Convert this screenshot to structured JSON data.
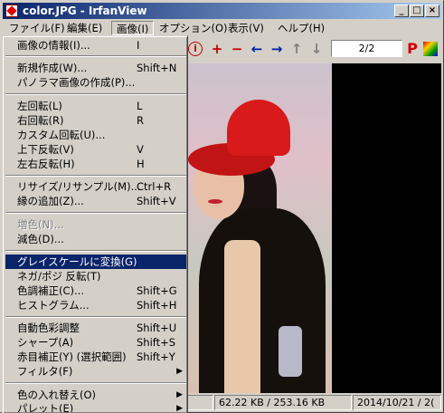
{
  "window": {
    "title": "color.JPG - IrfanView",
    "buttons": [
      "_",
      "□",
      "×"
    ]
  },
  "menubar": {
    "items": [
      {
        "label": "ファイル(F)"
      },
      {
        "label": "編集(E)"
      },
      {
        "label": "画像(I)"
      },
      {
        "label": "オプション(O)"
      },
      {
        "label": "表示(V)"
      },
      {
        "label": "ヘルプ(H)"
      }
    ]
  },
  "toolbar": {
    "page": "2/2",
    "icons": {
      "info": "i",
      "zoom_in": "+",
      "zoom_out": "−",
      "prev": "←",
      "next": "→",
      "up": "↑",
      "down": "↓",
      "print": "P"
    }
  },
  "image_menu": {
    "items": [
      {
        "label": "画像の情報(I)...",
        "shortcut": "I"
      },
      {
        "label": "新規作成(W)...",
        "shortcut": "Shift+N"
      },
      {
        "label": "パノラマ画像の作成(P)...",
        "shortcut": ""
      },
      {
        "label": "左回転(L)",
        "shortcut": "L"
      },
      {
        "label": "右回転(R)",
        "shortcut": "R"
      },
      {
        "label": "カスタム回転(U)...",
        "shortcut": ""
      },
      {
        "label": "上下反転(V)",
        "shortcut": "V"
      },
      {
        "label": "左右反転(H)",
        "shortcut": "H"
      },
      {
        "label": "リサイズ/リサンプル(M)...",
        "shortcut": "Ctrl+R"
      },
      {
        "label": "縁の追加(Z)...",
        "shortcut": "Shift+V"
      },
      {
        "label": "増色(N)...",
        "shortcut": ""
      },
      {
        "label": "減色(D)...",
        "shortcut": ""
      },
      {
        "label": "グレイスケールに変換(G)",
        "shortcut": ""
      },
      {
        "label": "ネガ/ポジ 反転(T)",
        "shortcut": ""
      },
      {
        "label": "色調補正(C)...",
        "shortcut": "Shift+G"
      },
      {
        "label": "ヒストグラム...",
        "shortcut": "Shift+H"
      },
      {
        "label": "自動色彩調整",
        "shortcut": "Shift+U"
      },
      {
        "label": "シャープ(A)",
        "shortcut": "Shift+S"
      },
      {
        "label": "赤目補正(Y) (選択範囲)",
        "shortcut": "Shift+Y"
      },
      {
        "label": "フィルタ(F)",
        "shortcut": ""
      },
      {
        "label": "色の入れ替え(O)",
        "shortcut": ""
      },
      {
        "label": "パレット(E)",
        "shortcut": ""
      }
    ]
  },
  "status": {
    "size": "62.22 KB / 253.16 KB",
    "date": "2014/10/21 / 2("
  }
}
